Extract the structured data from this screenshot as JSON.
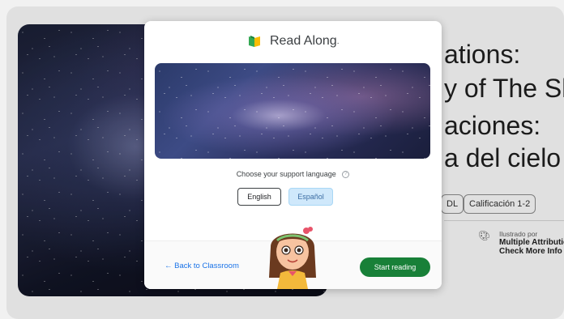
{
  "background": {
    "title_en_line1": "ations:",
    "title_en_line2": "y of The Sk",
    "title_es_line1": "aciones:",
    "title_es_line2": "a del cielo",
    "chips": [
      "DL",
      "Calificación 1-2"
    ],
    "illustration": {
      "label": "Ilustrado por",
      "name": "Multiple Attributions",
      "link": "Check More Info",
      "icon": "palette-icon"
    }
  },
  "dialog": {
    "brand": "Read Along",
    "brand_suffix": ".",
    "support_label": "Choose your support language",
    "help_icon": "?",
    "languages": [
      "English",
      "Español"
    ],
    "back_label": "← Back to Classroom",
    "start_label": "Start reading"
  },
  "colors": {
    "primary_green": "#188038",
    "link_blue": "#1a73e8",
    "selected_lang_bg": "#cfe8fb"
  }
}
